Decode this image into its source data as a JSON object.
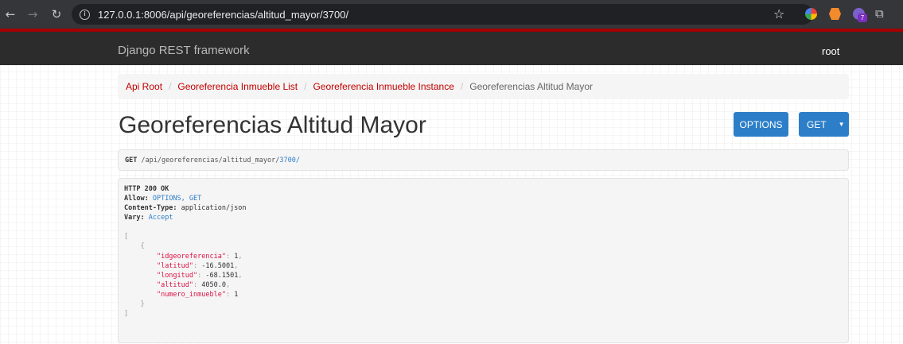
{
  "browser": {
    "url": "127.0.0.1:8006/api/georeferencias/altitud_mayor/3700/",
    "icons": [
      "back-icon",
      "forward-icon",
      "reload-icon",
      "info-icon",
      "star-icon",
      "puzzle-icon"
    ],
    "extension_badge": "7"
  },
  "navbar": {
    "brand": "Django REST framework",
    "user": "root",
    "accent_color": "#a30000"
  },
  "breadcrumb": {
    "items": [
      "Api Root",
      "Georeferencia Inmueble List",
      "Georeferencia Inmueble Instance"
    ],
    "active": "Georeferencias Altitud Mayor",
    "separator": "/"
  },
  "page": {
    "title": "Georeferencias Altitud Mayor",
    "options_label": "OPTIONS",
    "get_label": "GET",
    "caret": "▼",
    "button_color": "#2c7ec8"
  },
  "request": {
    "method": "GET",
    "path": "/api/georeferencias/altitud_mayor/",
    "id": "3700/"
  },
  "response": {
    "status": "HTTP 200 OK",
    "headers": [
      {
        "key": "Allow:",
        "value": "OPTIONS, GET",
        "link": true
      },
      {
        "key": "Content-Type:",
        "value": "application/json",
        "link": false
      },
      {
        "key": "Vary:",
        "value": "Accept",
        "link": true
      }
    ],
    "open_bracket": "[",
    "open_brace": "{",
    "fields": [
      {
        "key": "\"idgeoreferencia\"",
        "value": "1",
        "sep": ","
      },
      {
        "key": "\"latitud\"",
        "value": "-16.5001",
        "sep": ","
      },
      {
        "key": "\"longitud\"",
        "value": "-68.1501",
        "sep": ","
      },
      {
        "key": "\"altitud\"",
        "value": "4050.0",
        "sep": ","
      },
      {
        "key": "\"numero_inmueble\"",
        "value": "1",
        "sep": ""
      }
    ],
    "close_brace": "}",
    "close_bracket": "]"
  }
}
